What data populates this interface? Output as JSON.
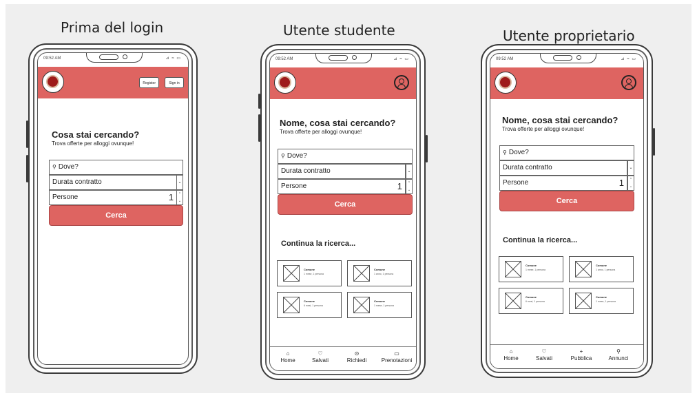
{
  "captions": {
    "guest": "Prima del login",
    "student": "Utente studente",
    "owner": "Utente proprietario"
  },
  "status": {
    "time": "09:52 AM",
    "signal": "⊿ ≈ ▭"
  },
  "guest": {
    "register": "Register",
    "signin": "Sign in",
    "title": "Cosa stai cercando?",
    "subtitle": "Trova offerte per alloggi ovunque!",
    "where_placeholder": "Dove?",
    "duration": "Durata contratto",
    "people": "Persone",
    "people_count": "1",
    "search": "Cerca"
  },
  "student": {
    "title": "Nome, cosa stai cercando?",
    "subtitle": "Trova offerte per alloggi ovunque!",
    "where_placeholder": "Dove?",
    "duration": "Durata contratto",
    "people": "Persone",
    "people_count": "1",
    "search": "Cerca",
    "continue": "Continua la ricerca...",
    "cards": [
      {
        "title": "Comune",
        "sub": "1 mese, 1 persona"
      },
      {
        "title": "Comune",
        "sub": "1 anno, 1 persona"
      },
      {
        "title": "Comune",
        "sub": "6 mesi, 1 persona"
      },
      {
        "title": "Comune",
        "sub": "1 mese, 1 persona"
      }
    ],
    "nav": [
      {
        "icon": "⌂",
        "label": "Home"
      },
      {
        "icon": "♡",
        "label": "Salvati"
      },
      {
        "icon": "⊙",
        "label": "Richiedi"
      },
      {
        "icon": "▭",
        "label": "Prenotazioni"
      }
    ]
  },
  "owner": {
    "title": "Nome, cosa stai cercando?",
    "subtitle": "Trova offerte per alloggi ovunque!",
    "where_placeholder": "Dove?",
    "duration": "Durata contratto",
    "people": "Persone",
    "people_count": "1",
    "search": "Cerca",
    "continue": "Continua la ricerca...",
    "cards": [
      {
        "title": "Comune",
        "sub": "1 mese, 1 persona"
      },
      {
        "title": "Comune",
        "sub": "1 anno, 1 persona"
      },
      {
        "title": "Comune",
        "sub": "6 mesi, 1 persona"
      },
      {
        "title": "Comune",
        "sub": "1 mese, 1 persona"
      }
    ],
    "nav": [
      {
        "icon": "⌂",
        "label": "Home"
      },
      {
        "icon": "♡",
        "label": "Salvati"
      },
      {
        "icon": "+",
        "label": "Pubblica"
      },
      {
        "icon": "⚲",
        "label": "Annunci"
      }
    ]
  },
  "colors": {
    "accent": "#de6461",
    "frame": "#3a3a3a",
    "background": "#efefef"
  }
}
